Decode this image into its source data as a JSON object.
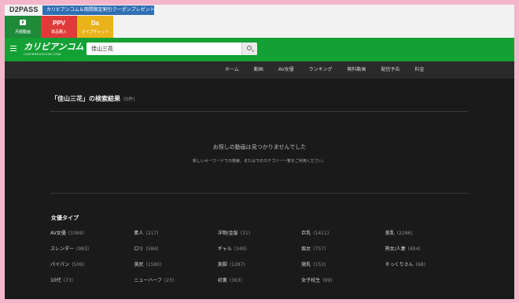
{
  "topbar": {
    "brand": "D2PASS",
    "promo": "カリビアンコム＆期間限定割引クーポンプレゼント中！"
  },
  "tiles": [
    {
      "label": "月額動画",
      "icon": "play-icon",
      "color": "#1e8a3a"
    },
    {
      "label": "単品購入",
      "icon_text": "PPV",
      "color": "#e03b3b"
    },
    {
      "label": "ライブチャット",
      "icon_text": "Dx",
      "color": "#eab31b"
    }
  ],
  "header": {
    "logo": "カリビアンコム",
    "logo_sub": "CARIBBEANCOM.COM",
    "search_value": "佳山三花"
  },
  "nav": [
    "ホーム",
    "動画",
    "AV女優",
    "ランキング",
    "無料動画",
    "配信予告",
    "料金"
  ],
  "results": {
    "title": "「佳山三花」の検索結果",
    "count": "(0件)",
    "not_found": "お探しの動画は見つかりませんでした",
    "hint": "新しいキーワードでの検索、または下のカテゴリー一覧をご利用ください。"
  },
  "section_title": "女優タイプ",
  "categories": [
    {
      "name": "AV女優",
      "count": "(3389)"
    },
    {
      "name": "素人",
      "count": "(217)"
    },
    {
      "name": "洋物/金髪",
      "count": "(31)"
    },
    {
      "name": "巨乳",
      "count": "(1411)"
    },
    {
      "name": "美乳",
      "count": "(2286)"
    },
    {
      "name": "スレンダー",
      "count": "(983)"
    },
    {
      "name": "ロリ",
      "count": "(584)"
    },
    {
      "name": "ギャル",
      "count": "(349)"
    },
    {
      "name": "痴女",
      "count": "(757)"
    },
    {
      "name": "熟女/人妻",
      "count": "(494)"
    },
    {
      "name": "パイパン",
      "count": "(509)"
    },
    {
      "name": "美尻",
      "count": "(1580)"
    },
    {
      "name": "美脚",
      "count": "(1287)"
    },
    {
      "name": "微乳",
      "count": "(153)"
    },
    {
      "name": "そっくりさん",
      "count": "(68)"
    },
    {
      "name": "10代",
      "count": "(73)"
    },
    {
      "name": "ニューハーフ",
      "count": "(23)"
    },
    {
      "name": "初裏",
      "count": "(363)"
    },
    {
      "name": "女子校生",
      "count": "(99)"
    }
  ]
}
